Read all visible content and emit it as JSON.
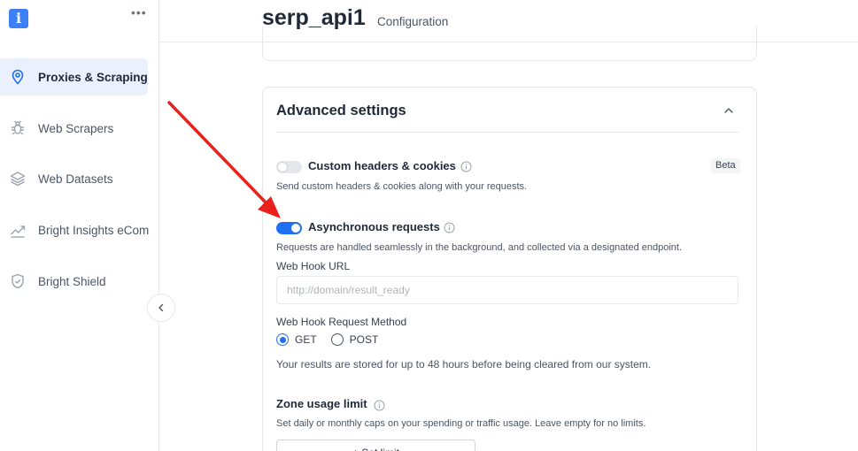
{
  "sidebar": {
    "more_label": "•••",
    "items": [
      {
        "label": "Proxies & Scraping",
        "icon": "location-pin-icon",
        "active": true
      },
      {
        "label": "Web Scrapers",
        "icon": "bug-icon",
        "active": false
      },
      {
        "label": "Web Datasets",
        "icon": "layers-icon",
        "active": false
      },
      {
        "label": "Bright Insights eCom",
        "icon": "trend-chart-icon",
        "active": false
      },
      {
        "label": "Bright Shield",
        "icon": "shield-check-icon",
        "active": false
      }
    ]
  },
  "header": {
    "title": "serp_api1",
    "subtitle": "Configuration"
  },
  "advanced": {
    "title": "Advanced settings",
    "custom_headers": {
      "title": "Custom headers & cookies",
      "badge": "Beta",
      "description": "Send custom headers & cookies along with your requests.",
      "enabled": false
    },
    "async": {
      "title": "Asynchronous requests",
      "description": "Requests are handled seamlessly in the background, and collected via a designated endpoint.",
      "enabled": true,
      "webhook_url_label": "Web Hook URL",
      "webhook_url_value": "",
      "webhook_url_placeholder": "http://domain/result_ready",
      "method_label": "Web Hook Request Method",
      "methods": [
        {
          "label": "GET",
          "checked": true
        },
        {
          "label": "POST",
          "checked": false
        }
      ],
      "storage_note": "Your results are stored for up to 48 hours before being cleared from our system."
    },
    "zone_limit": {
      "title": "Zone usage limit",
      "description": "Set daily or monthly caps on your spending or traffic usage. Leave empty for no limits.",
      "button_label": "+ Set limit"
    }
  },
  "colors": {
    "accent": "#1f6ff2",
    "active_nav_bg": "#eaf1fd",
    "annotation_arrow": "#e8211d",
    "logo": "#3d7ff5"
  }
}
